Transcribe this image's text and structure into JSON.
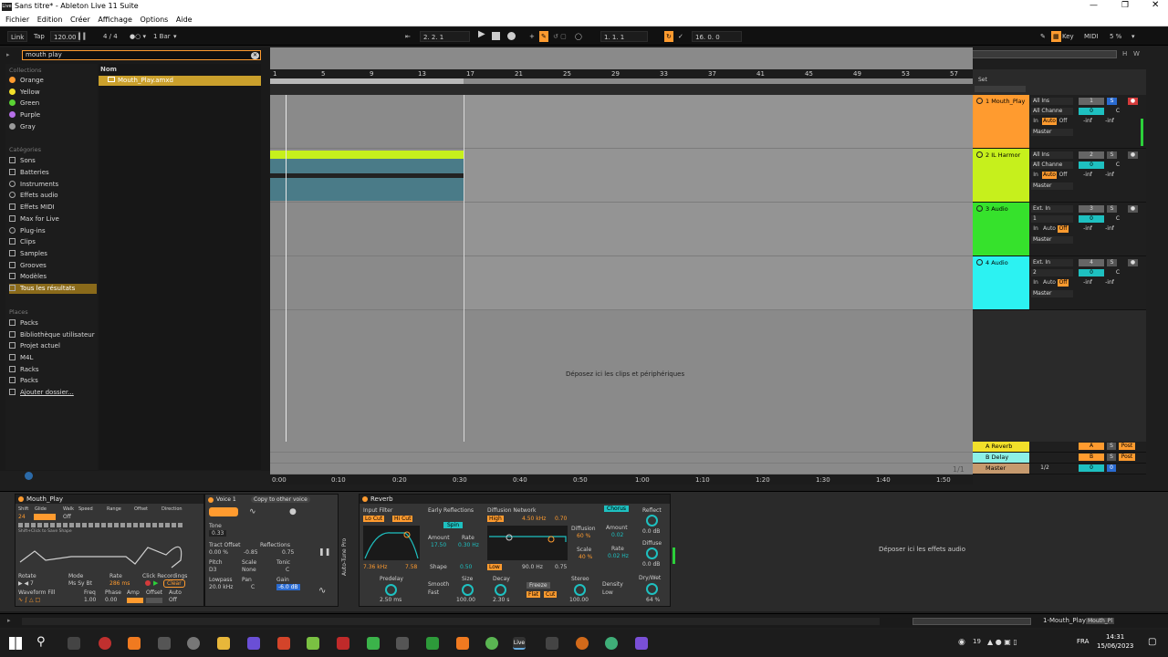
{
  "window": {
    "title": "Sans titre* - Ableton Live 11 Suite",
    "logo_text": "Live"
  },
  "menu": [
    "Fichier",
    "Edition",
    "Créer",
    "Affichage",
    "Options",
    "Aide"
  ],
  "control_bar": {
    "link": "Link",
    "tap": "Tap",
    "tempo": "120.00",
    "signature": "4 / 4",
    "metro": "1 Bar",
    "position": "2. 2. 1",
    "loop_start": "1. 1. 1",
    "loop_length": "16. 0. 0",
    "key": "Key",
    "midi": "MIDI",
    "cpu": "5 %"
  },
  "browser": {
    "search_value": "mouth play",
    "collections_label": "Collections",
    "collections": [
      {
        "name": "Orange",
        "color": "#ff9b2f"
      },
      {
        "name": "Yellow",
        "color": "#f2e02a"
      },
      {
        "name": "Green",
        "color": "#5ad334"
      },
      {
        "name": "Purple",
        "color": "#b66fe8"
      },
      {
        "name": "Gray",
        "color": "#9a9a9a"
      }
    ],
    "categories_label": "Catégories",
    "categories": [
      "Sons",
      "Batteries",
      "Instruments",
      "Effets audio",
      "Effets MIDI",
      "Max for Live",
      "Plug-ins",
      "Clips",
      "Samples",
      "Grooves",
      "Modèles",
      "Tous les résultats"
    ],
    "places_label": "Places",
    "places": [
      "Packs",
      "Bibliothèque utilisateur",
      "Projet actuel",
      "M4L",
      "Racks",
      "Packs",
      "Ajouter dossier..."
    ],
    "column_name": "Nom",
    "result": "Mouth_Play.amxd"
  },
  "arrangement": {
    "bar_marks": [
      "1",
      "5",
      "9",
      "13",
      "17",
      "21",
      "25",
      "29",
      "33",
      "37",
      "41",
      "45",
      "49",
      "53",
      "57"
    ],
    "time_marks": [
      "0:00",
      "0:10",
      "0:20",
      "0:30",
      "0:40",
      "0:50",
      "1:00",
      "1:10",
      "1:20",
      "1:30",
      "1:40",
      "1:50"
    ],
    "drop_hint": "Déposez ici les clips et périphériques",
    "set_label": "Set",
    "page": "1/1"
  },
  "tracks": [
    {
      "name": "1 Mouth_Play",
      "color": "#ff9b2f",
      "input": "All Ins",
      "channel": "All Channe",
      "output": "Master",
      "num": "1",
      "vol": "0",
      "pan": "C"
    },
    {
      "name": "2 IL Harmor",
      "color": "#c6f01c",
      "input": "All Ins",
      "channel": "All Channe",
      "output": "Master",
      "num": "2",
      "vol": "0",
      "pan": "C"
    },
    {
      "name": "3 Audio",
      "color": "#36e22c",
      "input": "Ext. In",
      "channel": "1",
      "output": "Master",
      "num": "3",
      "vol": "0",
      "pan": "C"
    },
    {
      "name": "4 Audio",
      "color": "#2cf2f2",
      "input": "Ext. In",
      "channel": "2",
      "output": "Master",
      "num": "4",
      "vol": "0",
      "pan": "C"
    }
  ],
  "returns": [
    {
      "name": "A Reverb",
      "color": "#f2e02a",
      "letter": "A",
      "mode": "Post"
    },
    {
      "name": "B Delay",
      "color": "#8cf0e6",
      "letter": "B",
      "mode": "Post"
    },
    {
      "name": "Master",
      "color": "#c69a6e",
      "cue": "1/2",
      "vol": "0"
    }
  ],
  "monitor": {
    "in": "In",
    "auto": "Auto",
    "off": "Off",
    "inf1": "-inf",
    "inf2": "-inf"
  },
  "mouth_play": {
    "title": "Mouth_Play",
    "headers": [
      "Shift",
      "Glide",
      "Walk",
      "Speed",
      "Range",
      "Offset",
      "Direction"
    ],
    "shift_val": "24",
    "glide_val": "Off",
    "hint": "Shift+Click to Save Shape",
    "rotate": "Rotate",
    "mode": "Mode",
    "rate": "Rate",
    "click_rec": "Click Recordings",
    "mode_vals": "Ms Sy Bt",
    "rate_val": "286 ms",
    "clear": "Clear",
    "wave_label": "Waveform Fill",
    "freq": "Freq",
    "phase": "Phase",
    "amp": "Amp",
    "offset": "Offset",
    "auto": "Auto",
    "freq_val": "1.00",
    "phase_val": "0.00",
    "auto_val": "Off"
  },
  "autotune": {
    "voice": "Voice 1",
    "copy": "Copy to other voice",
    "tone": "Tone",
    "tone_val": "0.33",
    "tract": "Tract Offset",
    "tract_val": "0.00 %",
    "reflections": "Reflections",
    "refl_val": "-0.85",
    "refl2": "0.75",
    "pitch": "Pitch",
    "pitch_val": "D3",
    "scale": "Scale",
    "scale_val": "None",
    "tonic": "Tonic",
    "tonic_val": "C",
    "lowpass": "Lowpass",
    "lowpass_val": "20.0 kHz",
    "pan": "Pan",
    "pan_val": "C",
    "gain": "Gain",
    "gain_val": "-6.0 dB",
    "side_label": "Auto-Tune Pro"
  },
  "reverb": {
    "title": "Reverb",
    "input_filter": "Input Filter",
    "locut": "Lo Cut",
    "hicut": "Hi Cut",
    "in_freq": "7.36 kHz",
    "in_width": "7.58",
    "early": "Early Reflections",
    "spin": "Spin",
    "amount": "Amount",
    "amount_val": "17.50",
    "rate": "Rate",
    "rate_val": "0.30 Hz",
    "shape": "Shape",
    "shape_val": "0.50",
    "diffusion_net": "Diffusion Network",
    "high": "High",
    "high_freq": "4.50 kHz",
    "high_val": "0.70",
    "low": "Low",
    "low_freq": "90.0 Hz",
    "low_val": "0.75",
    "diffusion": "Diffusion",
    "diffusion_val": "60 %",
    "scale": "Scale",
    "scale_val": "40 %",
    "chorus": "Chorus",
    "ch_amount": "Amount",
    "ch_amount_val": "0.02",
    "ch_rate": "Rate",
    "ch_rate_val": "0.02 Hz",
    "reflect": "Reflect",
    "reflect_val": "0.0 dB",
    "diffuse": "Diffuse",
    "diffuse_val": "0.0 dB",
    "predelay": "Predelay",
    "predelay_val": "2.50 ms",
    "smooth": "Smooth",
    "smooth_val": "Fast",
    "size": "Size",
    "size_val": "100.00",
    "decay": "Decay",
    "decay_val": "2.30 s",
    "freeze": "Freeze",
    "flat": "Flat",
    "cut": "Cut",
    "stereo": "Stereo",
    "stereo_val": "100.00",
    "density": "Density",
    "density_val": "Low",
    "drywet": "Dry/Wet",
    "drywet_val": "64 %"
  },
  "drop_effects": "Déposer ici les effets audio",
  "status": {
    "track": "1-Mouth_Play",
    "device": "Mouth_Pl"
  },
  "taskbar": {
    "lang": "FRA",
    "time": "14:31",
    "date": "15/06/2023",
    "temp": "19"
  }
}
